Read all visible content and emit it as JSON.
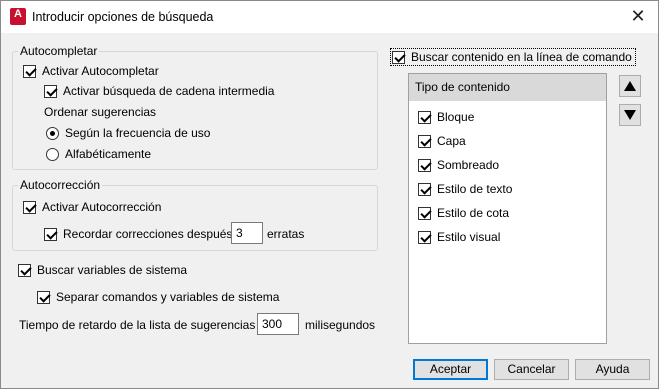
{
  "window": {
    "title": "Introducir opciones de búsqueda",
    "app_icon_letter": "A",
    "close_glyph": "✕"
  },
  "autocompletar": {
    "group_label": "Autocompletar",
    "activar": {
      "label": "Activar Autocompletar",
      "checked": true
    },
    "cadena_intermedia": {
      "label": "Activar búsqueda de cadena intermedia",
      "checked": true
    },
    "ordenar_label": "Ordenar sugerencias",
    "radio_frecuencia": {
      "label": "Según la frecuencia de uso",
      "selected": true
    },
    "radio_alfabetico": {
      "label": "Alfabéticamente",
      "selected": false
    }
  },
  "autocorreccion": {
    "group_label": "Autocorrección",
    "activar": {
      "label": "Activar Autocorrección",
      "checked": true
    },
    "recordar": {
      "label": "Recordar correcciones después",
      "checked": true
    },
    "erratas_value": "3",
    "erratas_label": "erratas"
  },
  "variables": {
    "buscar": {
      "label": "Buscar variables de sistema",
      "checked": true
    },
    "separar": {
      "label": "Separar comandos y variables de sistema",
      "checked": true
    }
  },
  "retardo": {
    "label": "Tiempo de retardo de la lista de sugerencias",
    "value": "300",
    "unit": "milisegundos"
  },
  "contenido": {
    "buscar_linea": {
      "label": "Buscar contenido en la línea de comando",
      "checked": true
    },
    "list_header": "Tipo de contenido",
    "items": [
      {
        "label": "Bloque",
        "checked": true
      },
      {
        "label": "Capa",
        "checked": true
      },
      {
        "label": "Sombreado",
        "checked": true
      },
      {
        "label": "Estilo de texto",
        "checked": true
      },
      {
        "label": "Estilo de cota",
        "checked": true
      },
      {
        "label": "Estilo visual",
        "checked": true
      }
    ]
  },
  "buttons": {
    "aceptar": "Aceptar",
    "cancelar": "Cancelar",
    "ayuda": "Ayuda"
  },
  "colors": {
    "app_icon_red": "#c8102e",
    "default_button_border": "#0078d7",
    "list_header_bg": "#d9d9d9"
  }
}
